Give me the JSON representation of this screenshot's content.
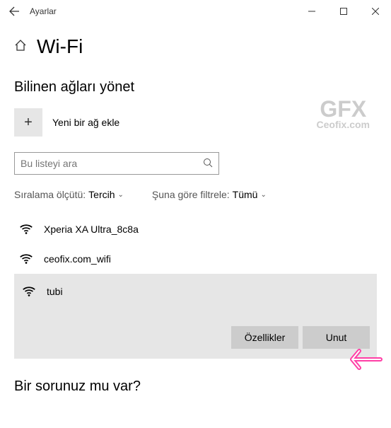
{
  "window": {
    "title": "Ayarlar"
  },
  "page": {
    "title": "Wi-Fi",
    "subheading": "Bilinen ağları yönet",
    "add_network": "Yeni bir ağ ekle",
    "search_placeholder": "Bu listeyi ara",
    "sort_label": "Sıralama ölçütü:",
    "sort_value": "Tercih",
    "filter_label": "Şuna göre filtrele:",
    "filter_value": "Tümü",
    "help_heading": "Bir sorunuz mu var?"
  },
  "networks": [
    {
      "name": "Xperia XA Ultra_8c8a",
      "selected": false
    },
    {
      "name": "ceofix.com_wifi",
      "selected": false
    },
    {
      "name": "tubi",
      "selected": true
    }
  ],
  "buttons": {
    "properties": "Özellikler",
    "forget": "Unut"
  },
  "watermark": {
    "logo_top": "GFX",
    "logo_sub": "Ceofix.com"
  }
}
